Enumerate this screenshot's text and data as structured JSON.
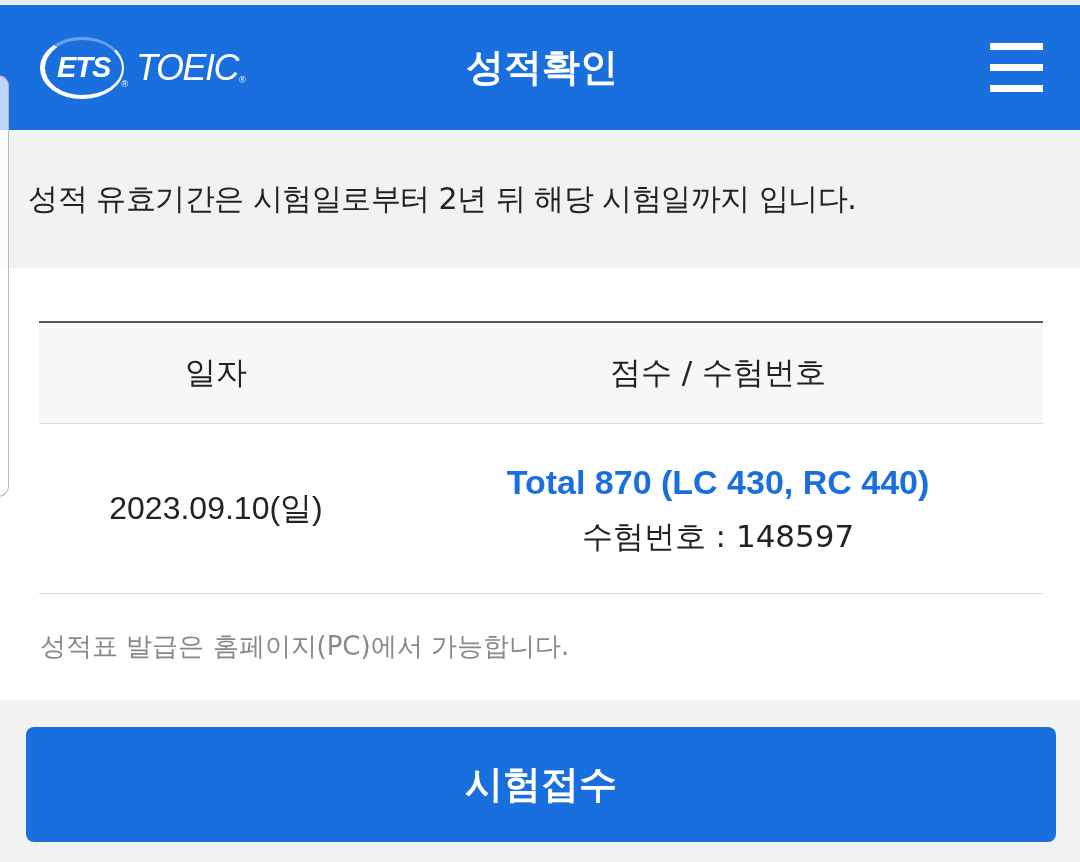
{
  "header": {
    "logo": {
      "mark": "ETS",
      "mark_reg": "®",
      "name": "TOEIC",
      "name_reg": "®"
    },
    "title": "성적확인"
  },
  "notice": "성적 유효기간은 시험일로부터 2년 뒤 해당 시험일까지 입니다.",
  "table": {
    "columns": [
      "일자",
      "점수 / 수험번호"
    ],
    "rows": [
      {
        "date": "2023.09.10(일)",
        "score": "Total 870 (LC 430, RC 440)",
        "exam_number": "수험번호 : 148597"
      }
    ]
  },
  "footnote": "성적표 발급은 홈페이지(PC)에서 가능합니다.",
  "button": "시험접수"
}
